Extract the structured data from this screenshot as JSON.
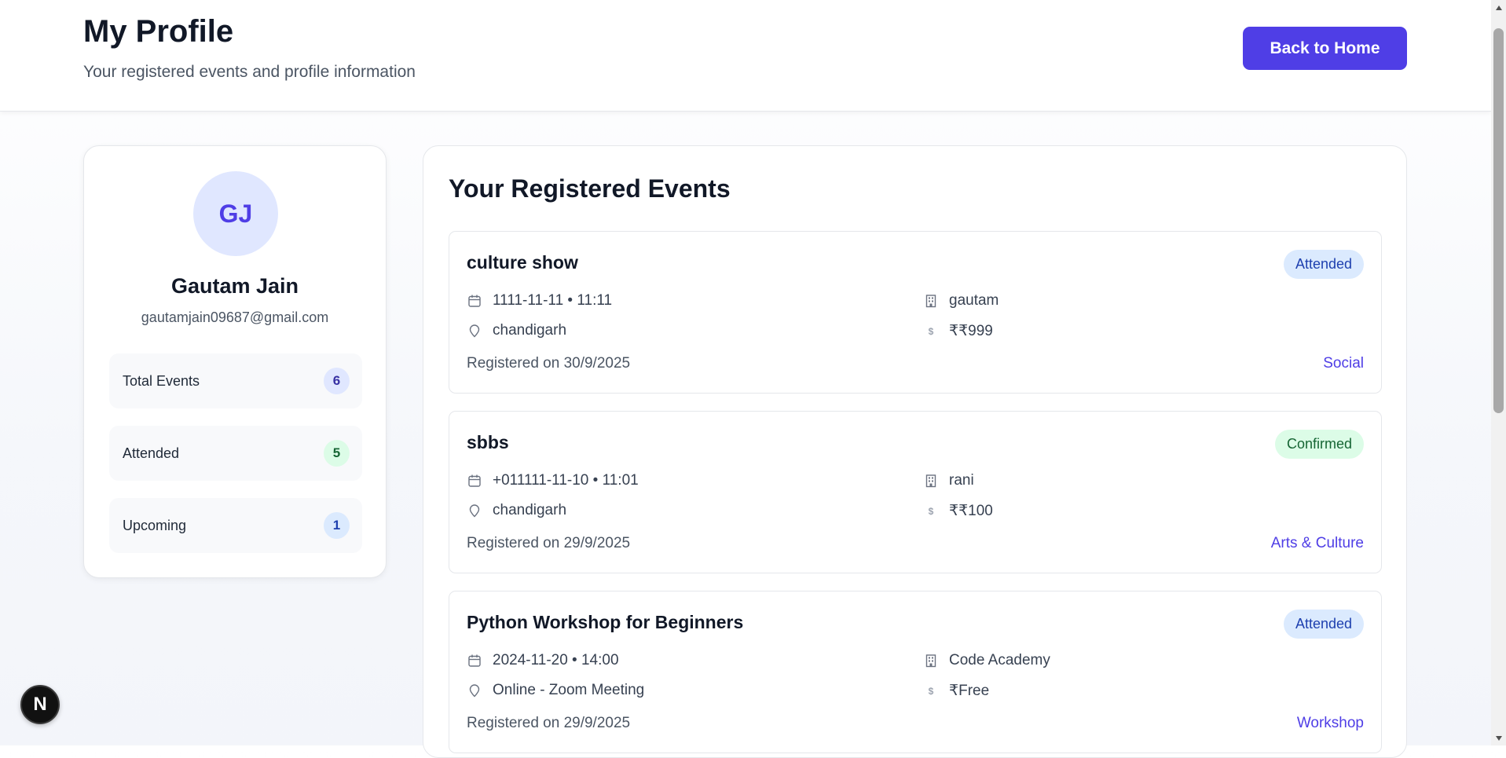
{
  "header": {
    "title": "My Profile",
    "subtitle": "Your registered events and profile information",
    "back_button": "Back to Home"
  },
  "profile": {
    "initials": "GJ",
    "name": "Gautam Jain",
    "email": "gautamjain09687@gmail.com",
    "stats": [
      {
        "label": "Total Events",
        "count": "6"
      },
      {
        "label": "Attended",
        "count": "5"
      },
      {
        "label": "Upcoming",
        "count": "1"
      }
    ]
  },
  "events_section": {
    "title": "Your Registered Events",
    "events": [
      {
        "name": "culture show",
        "status": "Attended",
        "datetime": "1111-11-11 • 11:11",
        "organizer": "gautam",
        "location": "chandigarh",
        "price": "₹₹999",
        "registered": "Registered on 30/9/2025",
        "category": "Social"
      },
      {
        "name": "sbbs",
        "status": "Confirmed",
        "datetime": "+011111-11-10 • 11:01",
        "organizer": "rani",
        "location": "chandigarh",
        "price": "₹₹100",
        "registered": "Registered on 29/9/2025",
        "category": "Arts & Culture"
      },
      {
        "name": "Python Workshop for Beginners",
        "status": "Attended",
        "datetime": "2024-11-20 • 14:00",
        "organizer": "Code Academy",
        "location": "Online - Zoom Meeting",
        "price": "₹Free",
        "registered": "Registered on 29/9/2025",
        "category": "Workshop"
      }
    ]
  },
  "icons": {
    "calendar": "calendar-icon",
    "building": "building-icon",
    "location": "map-pin-icon",
    "price": "dollar-icon",
    "dollar_glyph": "$"
  },
  "dev_badge": {
    "letter": "N"
  },
  "colors": {
    "accent": "#4f3ee6",
    "attended_badge": "#dbeafe",
    "confirmed_badge": "#dcfce7"
  }
}
